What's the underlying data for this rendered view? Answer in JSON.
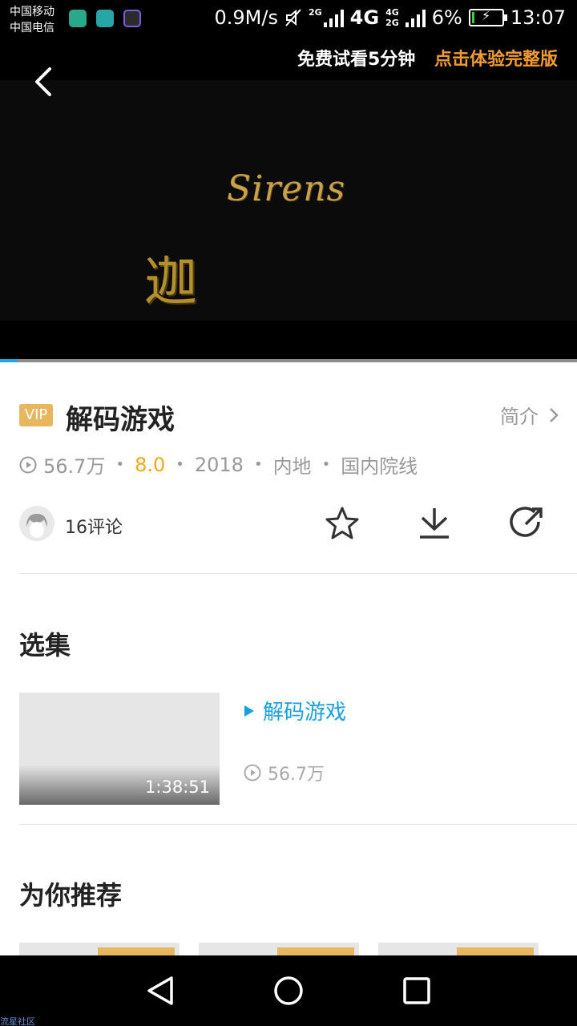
{
  "status_bar": {
    "carrier1": "中国移动",
    "carrier2": "中国电信",
    "speed": "0.9M/s",
    "net1": "2G",
    "net2": "4G",
    "net3": "4G",
    "net4": "2G",
    "battery": "6%",
    "battery_level": 0.06,
    "time": "13:07"
  },
  "player": {
    "trial_text": "免费试看5分钟",
    "trial_action": "点击体验完整版",
    "frame_text_en": "Sirens",
    "frame_text_cn": "迦",
    "progress_fraction": 0.03
  },
  "video": {
    "vip": "VIP",
    "title": "解码游戏",
    "intro": "简介",
    "views": "56.7万",
    "score": "8.0",
    "year": "2018",
    "region": "内地",
    "channel": "国内院线",
    "comments": "16评论"
  },
  "episodes": {
    "heading": "选集",
    "items": [
      {
        "title": "解码游戏",
        "duration": "1:38:51",
        "views": "56.7万"
      }
    ]
  },
  "recommend": {
    "heading": "为你推荐"
  },
  "watermark": "流星社区",
  "colors": {
    "accent_blue": "#1a9fe0",
    "vip_gold": "#e8b65c",
    "score_orange": "#f0a81c",
    "trial_orange": "#f29b30"
  }
}
